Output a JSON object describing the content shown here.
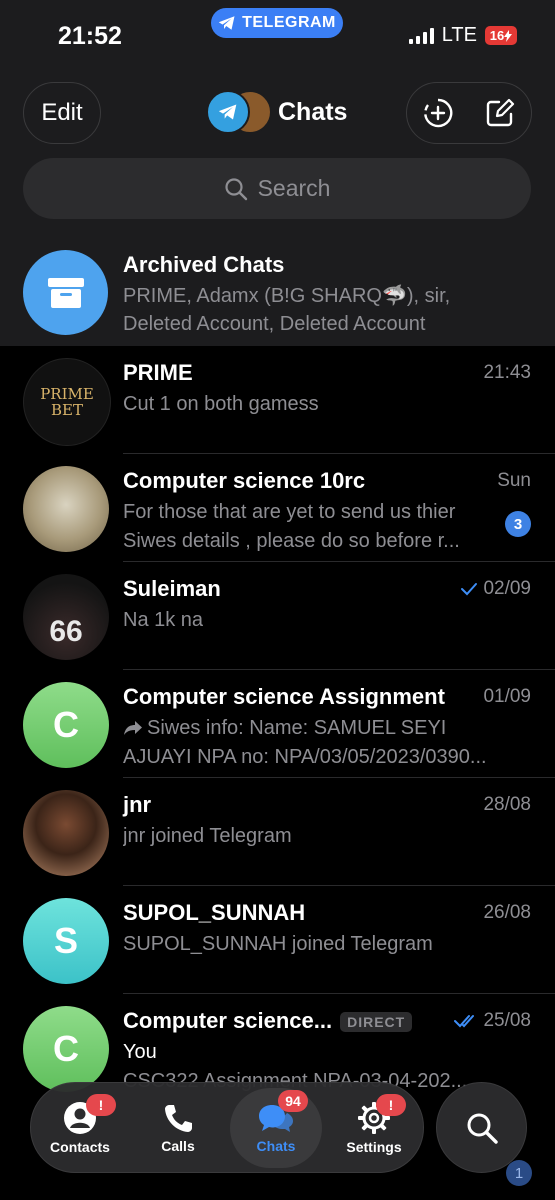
{
  "status": {
    "time": "21:52",
    "app_pill": "TELEGRAM",
    "network": "LTE",
    "battery": "16"
  },
  "header": {
    "edit_label": "Edit",
    "title": "Chats"
  },
  "search": {
    "placeholder": "Search"
  },
  "archived": {
    "title": "Archived Chats",
    "line1": "PRIME, Adamx (B!G SHARQ🦈), sir,",
    "line2": "Deleted Account, Deleted Account"
  },
  "chats": [
    {
      "name": "PRIME",
      "time": "21:43",
      "line1": "Cut 1 on both gamess",
      "line2": "",
      "avatar_text": "PRIME BET"
    },
    {
      "name": "Computer science 10rc",
      "time": "Sun",
      "line1": "For those that are yet to send us thier",
      "line2": "Siwes details , please do so before r...",
      "unread": "3"
    },
    {
      "name": "Suleiman",
      "time": "02/09",
      "line1": "Na 1k na",
      "line2": "",
      "avatar_text": "66",
      "read_status": "single-check"
    },
    {
      "name": "Computer science Assignment",
      "time": "01/09",
      "line1": "Siwes info: Name: SAMUEL SEYI",
      "line2": "AJUAYI NPA no: NPA/03/05/2023/0390...",
      "avatar_text": "C",
      "forwarded": true
    },
    {
      "name": "jnr",
      "time": "28/08",
      "line1": "jnr joined Telegram",
      "line2": ""
    },
    {
      "name": "SUPOL_SUNNAH",
      "time": "26/08",
      "line1": "SUPOL_SUNNAH joined Telegram",
      "line2": "",
      "avatar_text": "S"
    },
    {
      "name": "Computer science...",
      "tag": "DIRECT",
      "time": "25/08",
      "line1": "You",
      "line2": "CSC322 Assignment NPA-03-04-202...",
      "avatar_text": "C",
      "read_status": "double-check"
    }
  ],
  "tabbar": {
    "tabs": [
      {
        "label": "Contacts",
        "badge": "!"
      },
      {
        "label": "Calls"
      },
      {
        "label": "Chats",
        "badge": "94",
        "active": true
      },
      {
        "label": "Settings",
        "badge": "!"
      }
    ]
  },
  "bottom_peek": {
    "badge": "1"
  },
  "colors": {
    "accent": "#3e8ef7",
    "badge_red": "#e5484d",
    "archive_blue": "#4ea3ee",
    "green_avatar": "#7ed07a",
    "cyan_avatar": "#4fd6d0"
  }
}
